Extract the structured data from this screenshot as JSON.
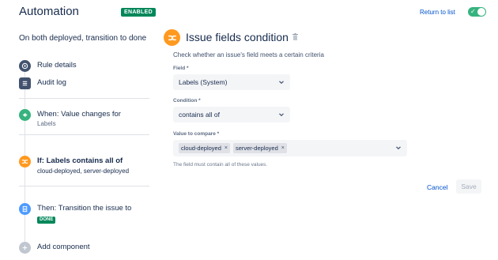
{
  "header": {
    "title": "Automation",
    "status_badge": "ENABLED",
    "return_link": "Return to list",
    "toggle_on": true,
    "toggle_check": "✓"
  },
  "sidebar": {
    "rule_name": "On both deployed, transition to done",
    "items": [
      {
        "label": "Rule details",
        "icon": "info-icon"
      },
      {
        "label": "Audit log",
        "icon": "list-icon"
      },
      {
        "label": "When: Value changes for",
        "sub": "Labels",
        "icon": "trigger-icon"
      },
      {
        "label": "If: Labels contains all of",
        "sub": "cloud-deployed, server-deployed",
        "icon": "shuffle-icon"
      },
      {
        "label": "Then: Transition the issue to",
        "badge": "DONE",
        "icon": "document-icon"
      },
      {
        "label": "Add component",
        "icon": "plus-icon"
      }
    ]
  },
  "condition": {
    "title": "Issue fields condition",
    "description": "Check whether an issue's field meets a certain criteria",
    "field_label": "Field *",
    "field_value": "Labels (System)",
    "condition_label": "Condition *",
    "condition_value": "contains all of",
    "compare_label": "Value to compare *",
    "chips": [
      "cloud-deployed",
      "server-deployed"
    ],
    "chip_remove": "×",
    "help": "The field must contain all of these values.",
    "cancel": "Cancel",
    "save": "Save"
  },
  "colors": {
    "accent": "#0052cc",
    "success": "#00875a",
    "condition": "#ff991f"
  }
}
